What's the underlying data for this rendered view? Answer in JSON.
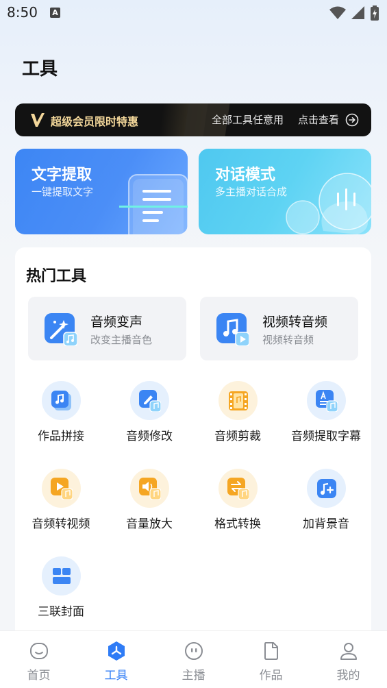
{
  "status_bar": {
    "time": "8:50",
    "a_badge": "A"
  },
  "page": {
    "title": "工具"
  },
  "vip_banner": {
    "title": "超级会员限时特惠",
    "description": "全部工具任意用",
    "cta": "点击查看",
    "accent_color": "#f3d79a"
  },
  "feature_cards": [
    {
      "title": "文字提取",
      "subtitle": "一键提取文字",
      "color": "#3d86f4"
    },
    {
      "title": "对话模式",
      "subtitle": "多主播对话合成",
      "color": "#4fc8f0"
    }
  ],
  "hot_tools": {
    "title": "热门工具",
    "featured": [
      {
        "name": "音频变声",
        "subtitle": "改变主播音色",
        "icon": "magic-wand-music-icon"
      },
      {
        "name": "视频转音频",
        "subtitle": "视频转音频",
        "icon": "music-video-icon"
      }
    ],
    "items": [
      {
        "label": "作品拼接",
        "icon": "music-stack-icon"
      },
      {
        "label": "音频修改",
        "icon": "edit-music-icon"
      },
      {
        "label": "音频剪裁",
        "icon": "film-music-icon"
      },
      {
        "label": "音频提取字幕",
        "icon": "subtitle-music-icon"
      },
      {
        "label": "音频转视频",
        "icon": "play-music-icon"
      },
      {
        "label": "音量放大",
        "icon": "volume-music-icon"
      },
      {
        "label": "格式转换",
        "icon": "convert-music-icon"
      },
      {
        "label": "加背景音",
        "icon": "add-music-icon"
      },
      {
        "label": "三联封面",
        "icon": "triptych-cover-icon"
      }
    ]
  },
  "bottom_nav": {
    "items": [
      {
        "label": "首页",
        "icon": "home-icon"
      },
      {
        "label": "工具",
        "icon": "tools-icon",
        "active": true
      },
      {
        "label": "主播",
        "icon": "anchor-icon"
      },
      {
        "label": "作品",
        "icon": "works-icon"
      },
      {
        "label": "我的",
        "icon": "profile-icon"
      }
    ],
    "active_color": "#2f7cf6"
  }
}
